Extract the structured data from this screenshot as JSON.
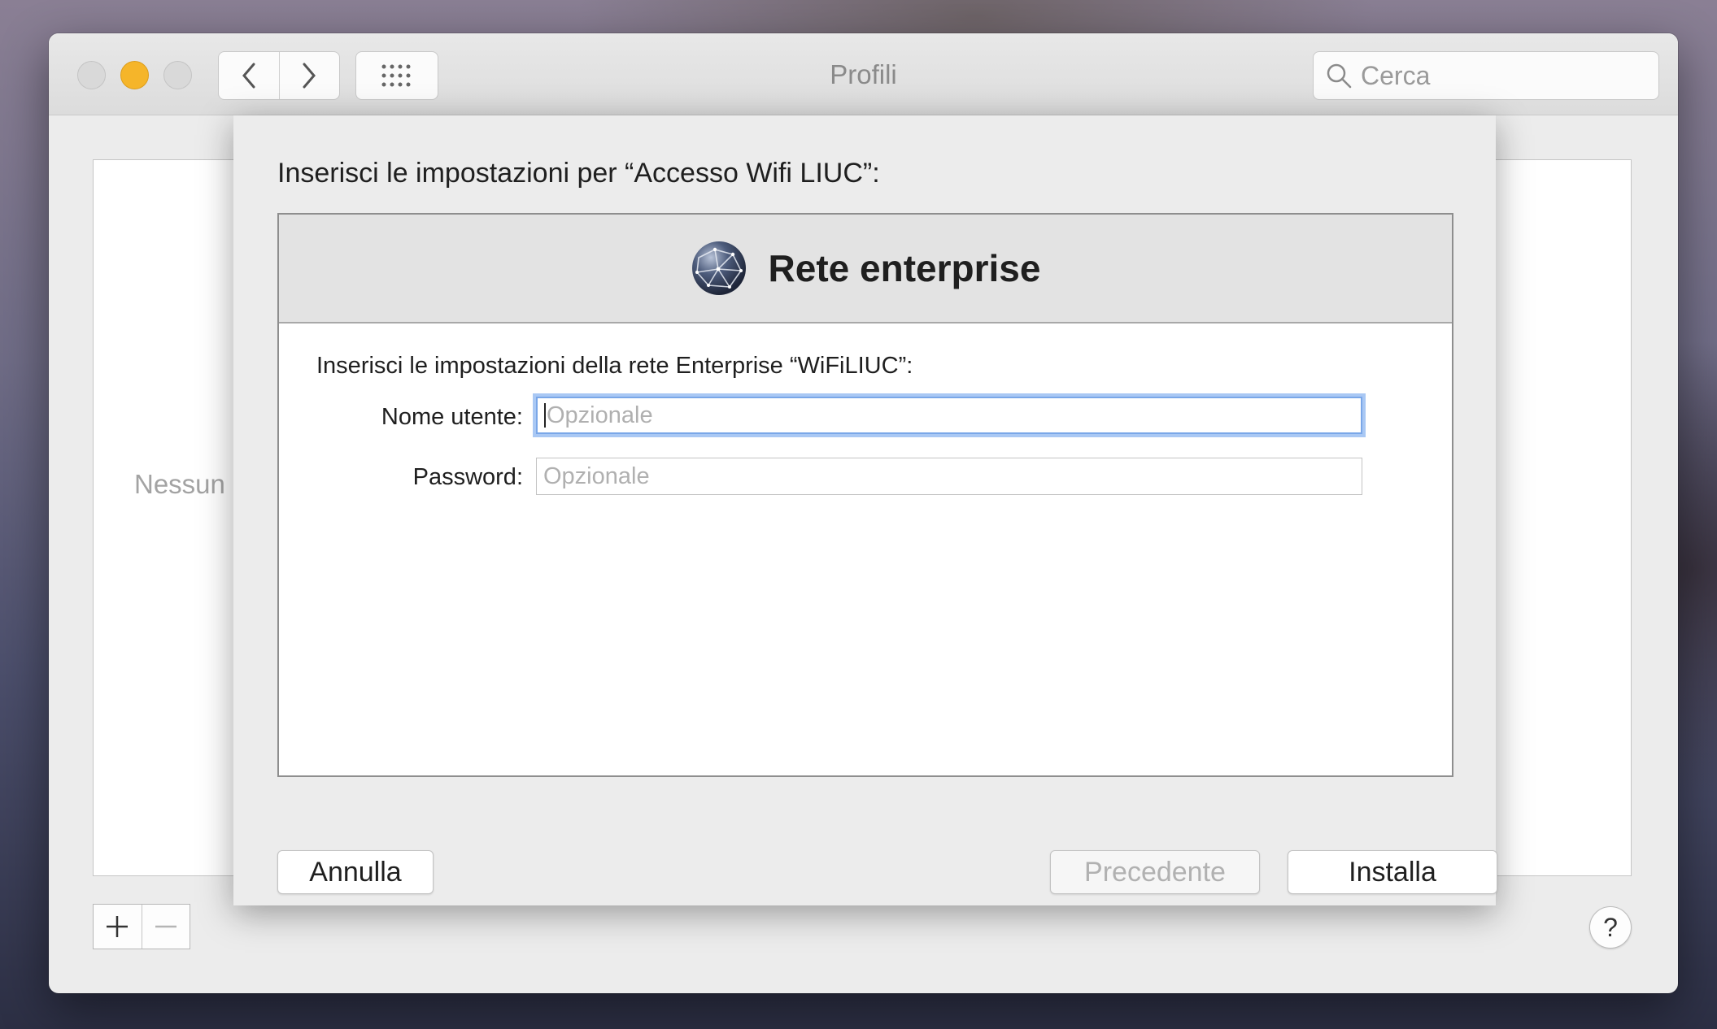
{
  "window": {
    "title": "Profili",
    "search_placeholder": "Cerca",
    "empty_text": "Nessun",
    "add_label": "+",
    "remove_label": "−",
    "help_label": "?"
  },
  "sheet": {
    "title": "Inserisci le impostazioni per “Accesso Wifi LIUC”:",
    "heading": "Rete enterprise",
    "instructions": "Inserisci le impostazioni della rete Enterprise “WiFiLIUC”:",
    "fields": {
      "username_label": "Nome utente:",
      "username_placeholder": "Opzionale",
      "password_label": "Password:",
      "password_placeholder": "Opzionale"
    },
    "buttons": {
      "cancel": "Annulla",
      "previous": "Precedente",
      "install": "Installa"
    }
  },
  "colors": {
    "minimize": "#f5b52a",
    "focus_ring": "#7aa7e8"
  }
}
